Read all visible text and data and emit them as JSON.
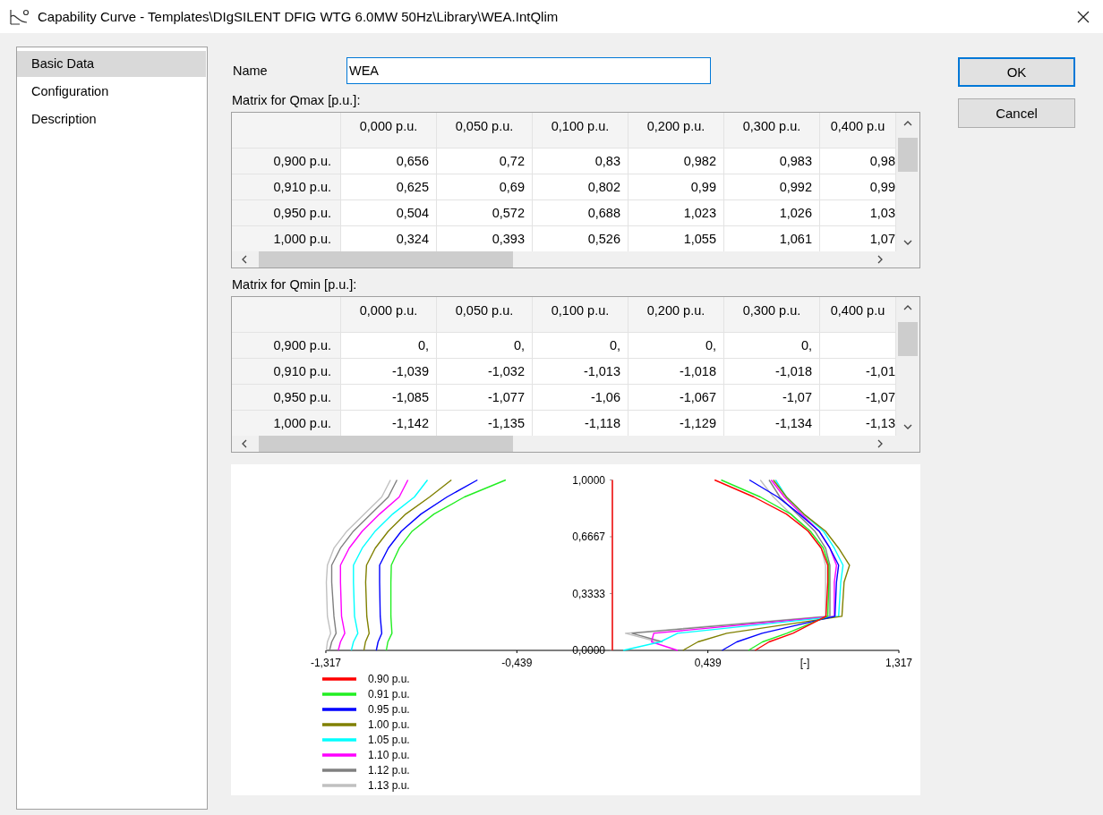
{
  "window": {
    "title": "Capability Curve - Templates\\DIgSILENT DFIG WTG 6.0MW 50Hz\\Library\\WEA.IntQlim"
  },
  "sidebar": {
    "items": [
      {
        "label": "Basic Data",
        "selected": true
      },
      {
        "label": "Configuration",
        "selected": false
      },
      {
        "label": "Description",
        "selected": false
      }
    ]
  },
  "name_field": {
    "label": "Name",
    "value": "WEA"
  },
  "tables": [
    {
      "title": "Matrix for Qmax [p.u.]:",
      "columns": [
        "0,000 p.u.",
        "0,050 p.u.",
        "0,100 p.u.",
        "0,200 p.u.",
        "0,300 p.u.",
        "0,400 p.u"
      ],
      "rows": [
        {
          "header": "0,900 p.u.",
          "cells": [
            "0,656",
            "0,72",
            "0,83",
            "0,982",
            "0,983",
            "0,98"
          ]
        },
        {
          "header": "0,910 p.u.",
          "cells": [
            "0,625",
            "0,69",
            "0,802",
            "0,99",
            "0,992",
            "0,99"
          ]
        },
        {
          "header": "0,950 p.u.",
          "cells": [
            "0,504",
            "0,572",
            "0,688",
            "1,023",
            "1,026",
            "1,03"
          ]
        },
        {
          "header": "1,000 p.u.",
          "cells": [
            "0,324",
            "0,393",
            "0,526",
            "1,055",
            "1,061",
            "1,07"
          ]
        }
      ]
    },
    {
      "title": "Matrix for Qmin [p.u.]:",
      "columns": [
        "0,000 p.u.",
        "0,050 p.u.",
        "0,100 p.u.",
        "0,200 p.u.",
        "0,300 p.u.",
        "0,400 p.u"
      ],
      "rows": [
        {
          "header": "0,900 p.u.",
          "cells": [
            "0,",
            "0,",
            "0,",
            "0,",
            "0,",
            null
          ]
        },
        {
          "header": "0,910 p.u.",
          "cells": [
            "-1,039",
            "-1,032",
            "-1,013",
            "-1,018",
            "-1,018",
            "-1,01"
          ]
        },
        {
          "header": "0,950 p.u.",
          "cells": [
            "-1,085",
            "-1,077",
            "-1,06",
            "-1,067",
            "-1,07",
            "-1,07"
          ]
        },
        {
          "header": "1,000 p.u.",
          "cells": [
            "-1,142",
            "-1,135",
            "-1,118",
            "-1,129",
            "-1,134",
            "-1,13"
          ]
        }
      ]
    }
  ],
  "chart": {
    "chart_data": {
      "type": "line",
      "orientation": "horizontal",
      "xlabel": "[-]",
      "legend": true,
      "x": [
        0,
        0.05,
        0.1,
        0.2,
        0.4,
        0.5,
        0.6,
        0.7,
        0.8,
        0.9,
        1.0,
        null,
        0,
        0.05,
        0.1,
        0.2,
        0.4,
        0.5,
        0.6,
        0.7,
        0.8,
        0.9,
        1.0
      ],
      "xlim": [
        -1.317,
        1.317
      ],
      "ylim": [
        0,
        1
      ],
      "xticks": [
        {
          "value": -1.317,
          "label": "-1,317"
        },
        {
          "value": -0.439,
          "label": "-0,439"
        },
        {
          "value": 0.439,
          "label": "0,439"
        },
        {
          "value": 1.317,
          "label": "1,317"
        }
      ],
      "yticks": [
        {
          "value": 0,
          "label": "0,0000"
        },
        {
          "value": 0.3333,
          "label": "0,3333"
        },
        {
          "value": 0.6667,
          "label": "0,6667"
        },
        {
          "value": 1,
          "label": "1,0000"
        }
      ],
      "series": [
        {
          "name": "0.90 p.u.",
          "color": "#ff0000",
          "values": [
            0,
            0,
            0,
            0,
            0,
            0,
            0,
            0,
            0,
            0,
            0,
            null,
            0.656,
            0.72,
            0.83,
            0.982,
            0.99,
            0.99,
            0.96,
            0.9,
            0.8,
            0.65,
            0.47
          ]
        },
        {
          "name": "0.91 p.u.",
          "color": "#22ee22",
          "values": [
            -1.039,
            -1.032,
            -1.013,
            -1.018,
            -1.018,
            -1.016,
            -0.98,
            -0.92,
            -0.82,
            -0.68,
            -0.49,
            null,
            0.625,
            0.69,
            0.802,
            0.99,
            0.995,
            0.995,
            0.97,
            0.91,
            0.82,
            0.68,
            0.5
          ]
        },
        {
          "name": "0.95 p.u.",
          "color": "#0000ff",
          "values": [
            -1.085,
            -1.077,
            -1.06,
            -1.067,
            -1.07,
            -1.07,
            -1.03,
            -0.97,
            -0.88,
            -0.76,
            -0.62,
            null,
            0.504,
            0.572,
            0.688,
            1.023,
            1.03,
            1.04,
            1.0,
            0.95,
            0.86,
            0.76,
            0.63
          ]
        },
        {
          "name": "1.00 p.u.",
          "color": "#808000",
          "values": [
            -1.142,
            -1.135,
            -1.118,
            -1.129,
            -1.134,
            -1.13,
            -1.09,
            -1.03,
            -0.95,
            -0.84,
            -0.74,
            null,
            0.324,
            0.393,
            0.526,
            1.055,
            1.065,
            1.09,
            1.04,
            0.98,
            0.88,
            0.8,
            0.74
          ]
        },
        {
          "name": "1.05 p.u.",
          "color": "#00ffff",
          "values": [
            -1.2,
            -1.19,
            -1.17,
            -1.185,
            -1.19,
            -1.19,
            -1.15,
            -1.09,
            -1.01,
            -0.91,
            -0.85,
            null,
            0.05,
            0.22,
            0.3,
            1.04,
            1.05,
            1.06,
            1.02,
            0.97,
            0.88,
            0.8,
            0.75
          ]
        },
        {
          "name": "1.10 p.u.",
          "color": "#ff00ff",
          "values": [
            -1.26,
            -1.25,
            -1.23,
            -1.245,
            -1.25,
            -1.25,
            -1.21,
            -1.15,
            -1.07,
            -0.98,
            -0.94,
            null,
            0.3,
            0.18,
            0.19,
            1.02,
            1.02,
            1.03,
            1.0,
            0.95,
            0.87,
            0.79,
            0.73
          ]
        },
        {
          "name": "1.12 p.u.",
          "color": "#808080",
          "values": [
            -1.3,
            -1.29,
            -1.27,
            -1.28,
            -1.29,
            -1.29,
            -1.25,
            -1.19,
            -1.11,
            -1.03,
            -0.99,
            null,
            null,
            0.23,
            0.09,
            1.0,
            1.0,
            1.0,
            0.98,
            0.93,
            0.85,
            0.77,
            0.72
          ]
        },
        {
          "name": "1.13 p.u.",
          "color": "#c0c0c0",
          "values": [
            -1.315,
            -1.31,
            -1.295,
            -1.31,
            -1.315,
            -1.31,
            -1.28,
            -1.22,
            -1.14,
            -1.06,
            -1.02,
            null,
            null,
            0.21,
            0.06,
            0.98,
            0.98,
            0.98,
            0.96,
            0.9,
            0.82,
            0.74,
            0.68
          ]
        }
      ]
    }
  },
  "buttons": [
    {
      "label": "OK",
      "default": true
    },
    {
      "label": "Cancel",
      "default": false
    }
  ]
}
